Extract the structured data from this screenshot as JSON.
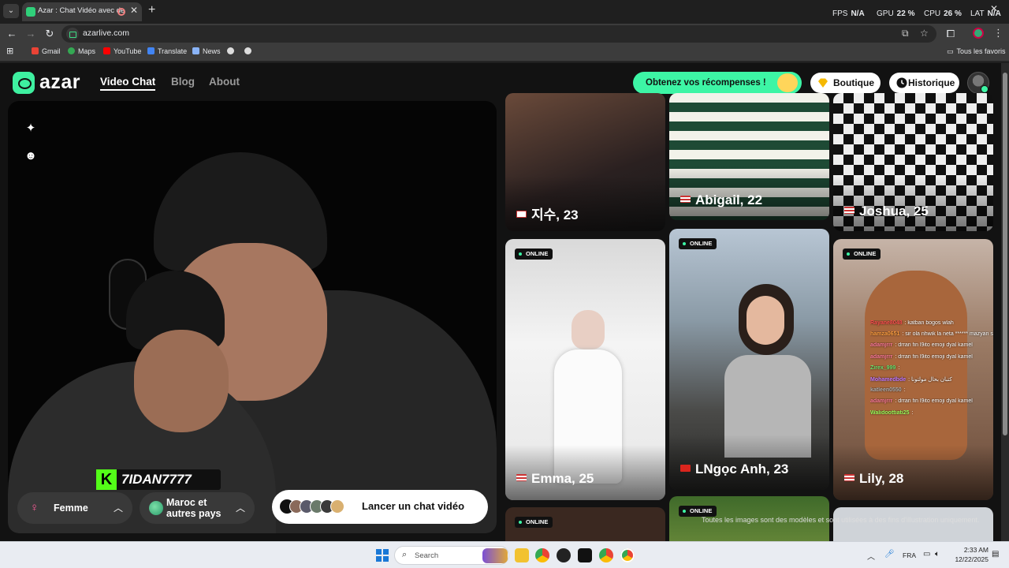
{
  "browser": {
    "tab_title": "Azar : Chat Vidéo avec de n",
    "url": "azarlive.com",
    "perf": {
      "fps_label": "FPS",
      "fps": "N/A",
      "gpu_label": "GPU",
      "gpu": "22 %",
      "cpu_label": "CPU",
      "cpu": "26 %",
      "lat_label": "LAT",
      "lat": "N/A"
    },
    "bookmarks": [
      "Gmail",
      "Maps",
      "YouTube",
      "Translate",
      "News"
    ],
    "all_bookmarks": "Tous les favoris"
  },
  "site": {
    "logo": "azar",
    "nav": [
      "Video Chat",
      "Blog",
      "About"
    ],
    "rewards": "Obtenez vos récompenses !",
    "shop": "Boutique",
    "history": "Historique"
  },
  "video": {
    "streamer": "7IDAN7777",
    "gender_filter": "Femme",
    "region_filter": "Maroc et autres pays",
    "launch": "Lancer un chat vidéo"
  },
  "profiles": [
    {
      "name": "지수, 23",
      "flag": "kr"
    },
    {
      "name": "Abigail, 22",
      "flag": "us"
    },
    {
      "name": "Joshua, 25",
      "flag": "us"
    },
    {
      "name": "Emma, 25",
      "flag": "us",
      "status": "ONLINE"
    },
    {
      "name": "LNgọc Anh, 23",
      "flag": "vn",
      "status": "ONLINE"
    },
    {
      "name": "Lily, 28",
      "flag": "us",
      "status": "ONLINE"
    },
    {
      "status": "ONLINE"
    },
    {
      "status": "ONLINE"
    }
  ],
  "chat": [
    {
      "user": "Rayane8048",
      "msg": ": katban bogos wlah"
    },
    {
      "user": "hamza0651",
      "msg": ": sir ola nhwik la neta ****** mazyan s"
    },
    {
      "user": "adamjrrr",
      "msg": ": drrari fin l9ito emoji dyal kamel"
    },
    {
      "user": "adamjrrr",
      "msg": ": drrari fin l9ito emoji dyal kamel"
    },
    {
      "user": "Zirex_999",
      "msg": ":"
    },
    {
      "user": "Mohamedbde",
      "msg": ": كتبان بحال مولتونا"
    },
    {
      "user": "katleen0550",
      "msg": ":"
    },
    {
      "user": "adamjrrr",
      "msg": ": drrari fin l9ito emoji dyal kamel"
    },
    {
      "user": "Walidoottiati25",
      "msg": ":"
    }
  ],
  "disclaimer": "Toutes les images sont des modèles et sont utilisées à des fins d'illustration uniquement.",
  "taskbar": {
    "search": "Search",
    "lang": "FRA",
    "time": "2:33 AM",
    "date": "12/22/2025"
  }
}
